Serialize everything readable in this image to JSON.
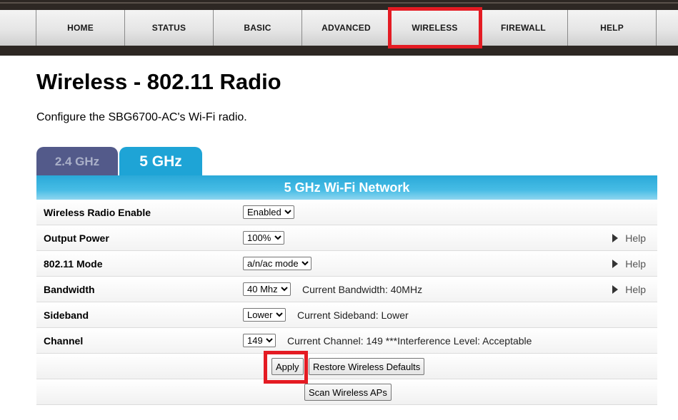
{
  "nav": {
    "items": [
      {
        "label": "HOME"
      },
      {
        "label": "STATUS"
      },
      {
        "label": "BASIC"
      },
      {
        "label": "ADVANCED"
      },
      {
        "label": "WIRELESS",
        "active": true
      },
      {
        "label": "FIREWALL"
      },
      {
        "label": "HELP"
      }
    ]
  },
  "page": {
    "title": "Wireless - 802.11 Radio",
    "description": "Configure the SBG6700-AC's Wi-Fi radio."
  },
  "tabs": {
    "band_24": "2.4 GHz",
    "band_5": "5 GHz",
    "active": "5 GHz"
  },
  "panel": {
    "title": "5 GHz Wi-Fi Network",
    "rows": {
      "radio_enable": {
        "label": "Wireless Radio Enable",
        "value": "Enabled"
      },
      "output_power": {
        "label": "Output Power",
        "value": "100%",
        "help": "Help"
      },
      "mode": {
        "label": "802.11 Mode",
        "value": "a/n/ac mode",
        "help": "Help"
      },
      "bandwidth": {
        "label": "Bandwidth",
        "value": "40 Mhz",
        "info": "Current Bandwidth: 40MHz",
        "help": "Help"
      },
      "sideband": {
        "label": "Sideband",
        "value": "Lower",
        "info": "Current Sideband: Lower"
      },
      "channel": {
        "label": "Channel",
        "value": "149",
        "info": "Current Channel: 149 ***Interference Level: Acceptable"
      }
    },
    "buttons": {
      "apply": "Apply",
      "restore": "Restore Wireless Defaults",
      "scan": "Scan Wireless APs"
    }
  },
  "colors": {
    "highlight": "#e41b23",
    "tab_active": "#1ea4d6",
    "tab_inactive": "#535a8a",
    "header_band": "#2d2723"
  }
}
